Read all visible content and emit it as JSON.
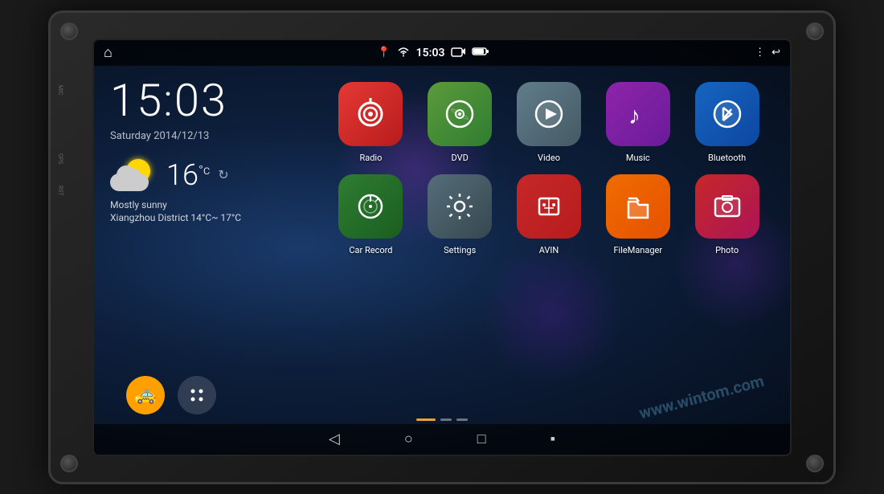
{
  "device": {
    "side_labels": {
      "mic": "MIC",
      "gps": "GPS",
      "rst": "RST"
    }
  },
  "status_bar": {
    "home_icon": "⌂",
    "location_icon": "▾",
    "wifi_icon": "WiFi",
    "time": "15:03",
    "camera_icon": "📷",
    "battery_icon": "▭",
    "menu_icon": "⋮",
    "back_icon": "↩"
  },
  "left_panel": {
    "clock": "15:03",
    "date": "Saturday 2014/12/13",
    "temperature": "16",
    "temp_unit": "°c",
    "weather_desc": "Mostly sunny",
    "weather_location": "Xiangzhou District 14°C~\n17°C"
  },
  "apps": [
    {
      "id": "radio",
      "label": "Radio",
      "icon": "📡",
      "color_class": "icon-radio"
    },
    {
      "id": "dvd",
      "label": "DVD",
      "icon": "💿",
      "color_class": "icon-dvd"
    },
    {
      "id": "video",
      "label": "Video",
      "icon": "▶",
      "color_class": "icon-video"
    },
    {
      "id": "music",
      "label": "Music",
      "icon": "♪",
      "color_class": "icon-music"
    },
    {
      "id": "bluetooth",
      "label": "Bluetooth",
      "icon": "⊕",
      "color_class": "icon-bluetooth"
    },
    {
      "id": "carrecord",
      "label": "Car Record",
      "icon": "⊙",
      "color_class": "icon-carrecord"
    },
    {
      "id": "settings",
      "label": "Settings",
      "icon": "⚙",
      "color_class": "icon-settings"
    },
    {
      "id": "avin",
      "label": "AVIN",
      "icon": "⑁",
      "color_class": "icon-avin"
    },
    {
      "id": "filemanager",
      "label": "FileManager",
      "icon": "📁",
      "color_class": "icon-filemanager"
    },
    {
      "id": "photo",
      "label": "Photo",
      "icon": "🖼",
      "color_class": "icon-photo"
    }
  ],
  "bottom_icons": {
    "taxi_icon": "🚕",
    "dots_icon": "⠿"
  },
  "page_indicator": {
    "dots": [
      "active",
      "inactive",
      "inactive"
    ]
  },
  "nav_bar": {
    "back": "◁",
    "home": "○",
    "recent": "□"
  },
  "watermark": "www.wintom.com"
}
